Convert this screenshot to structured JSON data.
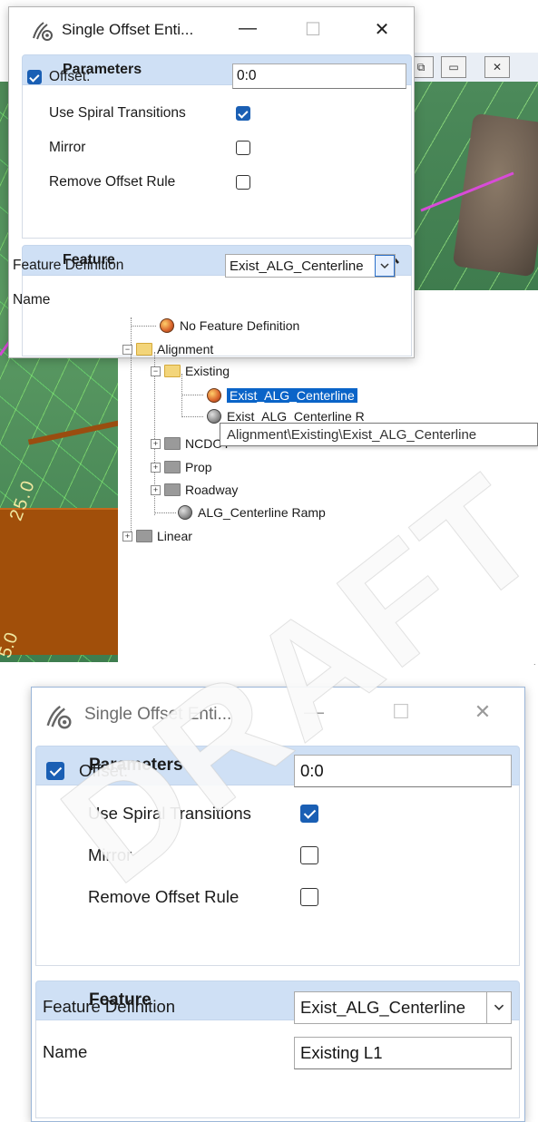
{
  "top_dialog": {
    "title": "Single Offset Enti...",
    "minimize": "—",
    "maximize": "☐",
    "close": "✕",
    "parameters": {
      "header": "Parameters",
      "offset_label": "Offset:",
      "offset_checked": true,
      "offset_value": "0:0",
      "spiral_label": "Use Spiral Transitions",
      "spiral_checked": true,
      "mirror_label": "Mirror",
      "mirror_checked": false,
      "remove_rule_label": "Remove Offset Rule",
      "remove_rule_checked": false
    },
    "feature": {
      "header": "Feature",
      "definition_label": "Feature Definition",
      "definition_value": "Exist_ALG_Centerline",
      "name_label": "Name"
    }
  },
  "tree": {
    "items": [
      {
        "label": "No Feature Definition"
      },
      {
        "label": "Alignment"
      },
      {
        "label": "Existing"
      },
      {
        "label": "Exist_ALG_Centerline"
      },
      {
        "label": "Exist_ALG_Centerline R"
      },
      {
        "label": "NCDOT"
      },
      {
        "label": "Prop"
      },
      {
        "label": "Roadway"
      },
      {
        "label": "ALG_Centerline Ramp"
      },
      {
        "label": "Linear"
      }
    ],
    "tooltip": "Alignment\\Existing\\Exist_ALG_Centerline"
  },
  "bottom_dialog": {
    "title": "Single Offset Enti...",
    "minimize": "—",
    "maximize": "☐",
    "close": "✕",
    "parameters": {
      "header": "Parameters",
      "offset_label": "Offset:",
      "offset_checked": true,
      "offset_value": "0:0",
      "spiral_label": "Use Spiral Transitions",
      "spiral_checked": true,
      "mirror_label": "Mirror",
      "mirror_checked": false,
      "remove_rule_label": "Remove Offset Rule",
      "remove_rule_checked": false
    },
    "feature": {
      "header": "Feature",
      "definition_label": "Feature Definition",
      "definition_value": "Exist_ALG_Centerline",
      "name_label": "Name",
      "name_value": "Existing L1"
    }
  },
  "background_window": {
    "restore": "⧉",
    "minimize_box": "▭",
    "close": "✕"
  },
  "scene_text": {
    "station_1": "25.0",
    "station_2": "5.0"
  },
  "watermark": "DRAFT",
  "colors": {
    "section_header": "#cfe0f5",
    "checkbox_checked": "#1a5fb4",
    "selection": "#0a64c8"
  }
}
